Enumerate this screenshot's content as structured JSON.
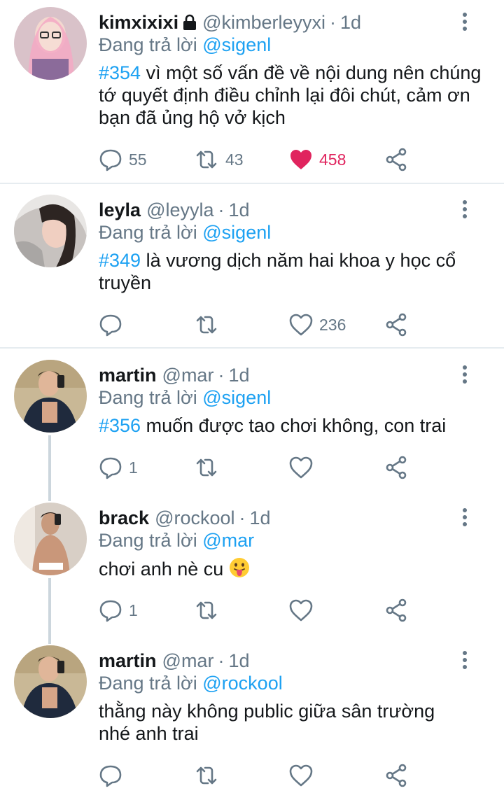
{
  "tweets": [
    {
      "name": "kimxixixi",
      "protected": true,
      "handle": "@kimberleyyxi",
      "dot": "·",
      "time": "1d",
      "replying_prefix": "Đang trả lời ",
      "replying_to": "@sigenl",
      "hashtag": "#354",
      "text": " vì một số vấn đề về nội dung nên chúng tớ quyết định điều chỉnh lại đôi chút, cảm ơn bạn đã ủng hộ vở kịch",
      "replies": "55",
      "retweets": "43",
      "likes": "458",
      "liked": true
    },
    {
      "name": "leyla",
      "handle": "@leyyla",
      "dot": "·",
      "time": "1d",
      "replying_prefix": "Đang trả lời ",
      "replying_to": "@sigenl",
      "hashtag": "#349",
      "text": " là vương dịch năm hai khoa y học cổ truyền",
      "replies": "",
      "retweets": "",
      "likes": "236"
    },
    {
      "name": "martin",
      "handle": "@mar",
      "dot": "·",
      "time": "1d",
      "replying_prefix": "Đang trả lời ",
      "replying_to": "@sigenl",
      "hashtag": "#356",
      "text": " muốn được tao chơi không, con trai",
      "replies": "1",
      "retweets": "",
      "likes": ""
    },
    {
      "name": "brack",
      "handle": "@rockool",
      "dot": "·",
      "time": "1d",
      "replying_prefix": "Đang trả lời ",
      "replying_to": "@mar",
      "text": "chơi anh nè cu ",
      "emoji": "face-with-tongue-emoji",
      "replies": "1",
      "retweets": "",
      "likes": ""
    },
    {
      "name": "martin",
      "handle": "@mar",
      "dot": "·",
      "time": "1d",
      "replying_prefix": "Đang trả lời ",
      "replying_to": "@rockool",
      "text": "thằng này không public giữa sân trường nhé anh trai",
      "replies": "",
      "retweets": "",
      "likes": ""
    }
  ],
  "icons": {
    "reply": "reply-icon",
    "retweet": "retweet-icon",
    "like": "heart-icon",
    "share": "share-icon",
    "more": "more-vertical-icon",
    "lock": "lock-icon"
  },
  "colors": {
    "link": "#1da1f2",
    "muted": "#657786",
    "like_active": "#e0245e",
    "divider": "#e6ecf0",
    "thread_line": "#ccd6dd"
  }
}
